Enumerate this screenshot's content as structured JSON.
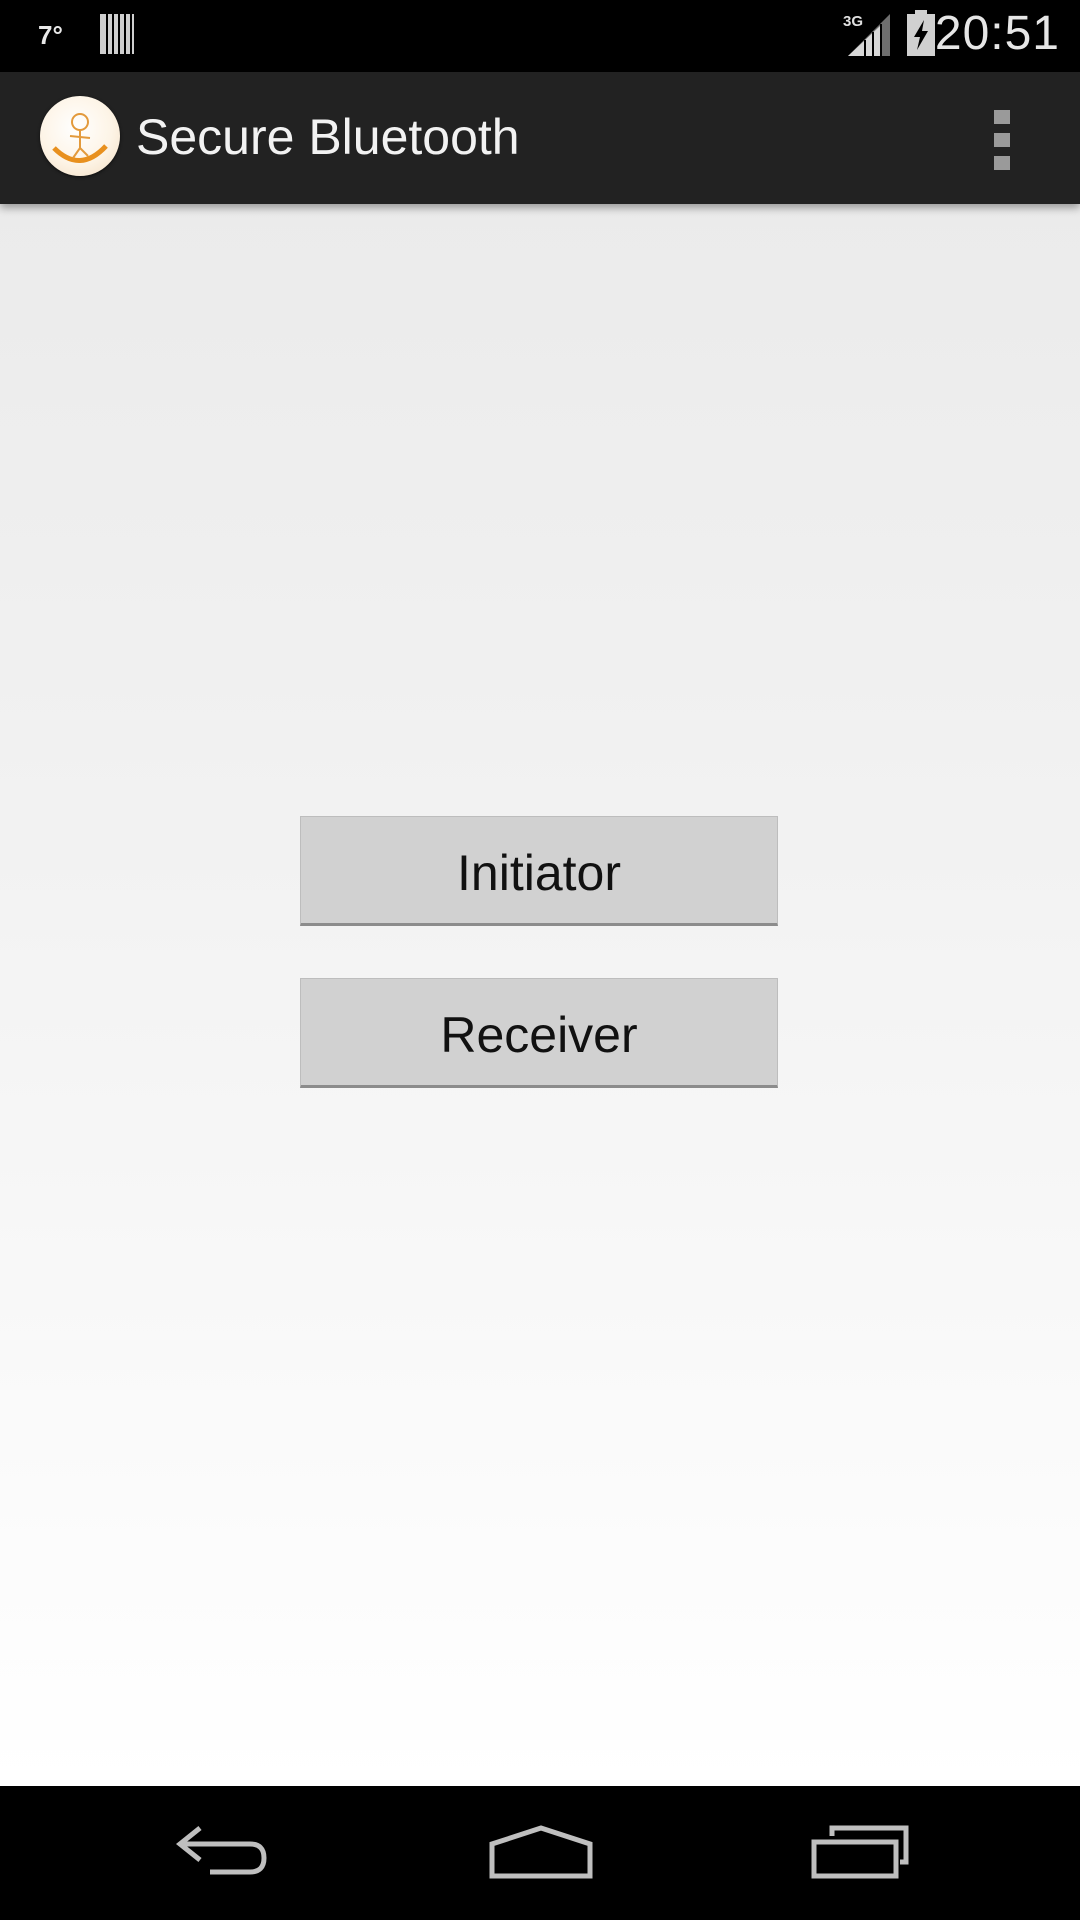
{
  "status_bar": {
    "temperature": "7°",
    "time": "20:51",
    "network_label": "3G",
    "icons": [
      "barcode-icon",
      "signal-3g-icon",
      "battery-charging-icon"
    ]
  },
  "action_bar": {
    "title": "Secure Bluetooth",
    "app_icon": "app-logo-icon",
    "menu_icon": "overflow-menu-icon"
  },
  "main": {
    "buttons": [
      {
        "label": "Initiator"
      },
      {
        "label": "Receiver"
      }
    ]
  },
  "nav_bar": {
    "icons": [
      "back-icon",
      "home-icon",
      "recent-apps-icon"
    ]
  },
  "colors": {
    "action_bar_bg": "#222222",
    "button_bg": "#d1d1d1",
    "content_bg_top": "#ebebeb",
    "content_bg_bottom": "#ffffff"
  }
}
